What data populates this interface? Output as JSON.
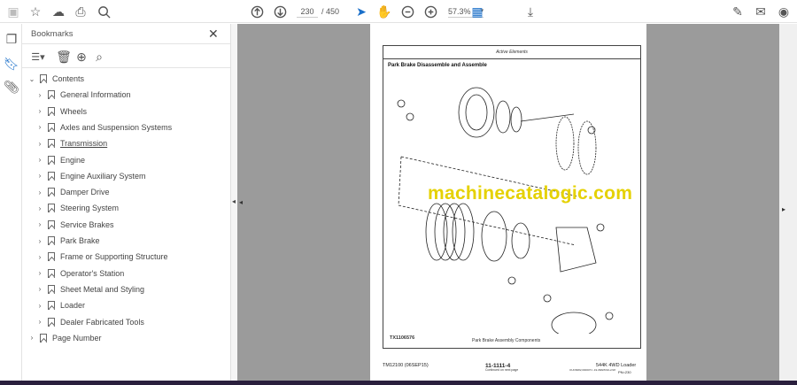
{
  "toolbar": {
    "page_current": "230",
    "page_total": "/ 450",
    "zoom": "57.3%"
  },
  "bookmarks": {
    "title": "Bookmarks",
    "close": "✕",
    "root": "Contents",
    "items": [
      "General Information",
      "Wheels",
      "Axles and Suspension Systems",
      "Transmission",
      "Engine",
      "Engine Auxiliary System",
      "Damper Drive",
      "Steering System",
      "Service Brakes",
      "Park Brake",
      "Frame or Supporting Structure",
      "Operator's Station",
      "Sheet Metal and Styling",
      "Loader",
      "Dealer Fabricated Tools"
    ],
    "last": "Page Number"
  },
  "document": {
    "header": "Active Elements",
    "title": "Park Brake Disassemble and Assemble",
    "figure_id": "TX1106576",
    "caption": "Park Brake Assembly Components",
    "continued": "Continued on next page",
    "code": "OUO6082,0000071 -19-08APR10-2/18",
    "footer_left": "TM12100 (06SEP15)",
    "footer_center": "11-1111-4",
    "footer_right": "544K 4WD Loader",
    "footer_right2": "PN=230",
    "watermark": "machinecatalogic.com"
  }
}
